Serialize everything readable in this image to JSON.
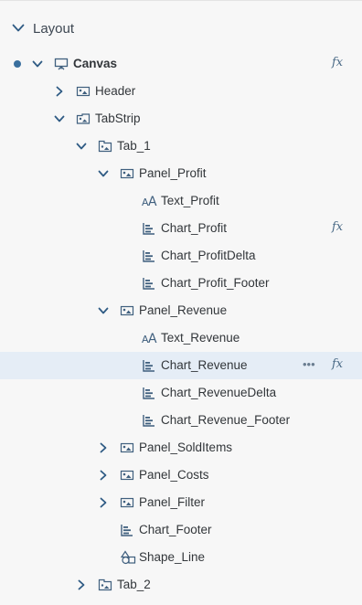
{
  "panel": {
    "title": "Layout"
  },
  "tree": [
    {
      "label": "Canvas",
      "level": 0,
      "expand": "expanded",
      "icon": "canvas-icon",
      "bold": true,
      "dot": true,
      "fx": "fx"
    },
    {
      "label": "Header",
      "level": 1,
      "expand": "collapsed",
      "icon": "panel-icon"
    },
    {
      "label": "TabStrip",
      "level": 1,
      "expand": "expanded",
      "icon": "tabstrip-icon"
    },
    {
      "label": "Tab_1",
      "level": 2,
      "expand": "expanded",
      "icon": "tab-icon"
    },
    {
      "label": "Panel_Profit",
      "level": 3,
      "expand": "expanded",
      "icon": "panel-icon"
    },
    {
      "label": "Text_Profit",
      "level": 4,
      "expand": "none",
      "icon": "text-icon"
    },
    {
      "label": "Chart_Profit",
      "level": 4,
      "expand": "none",
      "icon": "chart-icon",
      "fx": "fx"
    },
    {
      "label": "Chart_ProfitDelta",
      "level": 4,
      "expand": "none",
      "icon": "chart-icon"
    },
    {
      "label": "Chart_Profit_Footer",
      "level": 4,
      "expand": "none",
      "icon": "chart-icon"
    },
    {
      "label": "Panel_Revenue",
      "level": 3,
      "expand": "expanded",
      "icon": "panel-icon"
    },
    {
      "label": "Text_Revenue",
      "level": 4,
      "expand": "none",
      "icon": "text-icon"
    },
    {
      "label": "Chart_Revenue",
      "level": 4,
      "expand": "none",
      "icon": "chart-icon",
      "selected": true,
      "more": "•••",
      "fx": "fx"
    },
    {
      "label": "Chart_RevenueDelta",
      "level": 4,
      "expand": "none",
      "icon": "chart-icon"
    },
    {
      "label": "Chart_Revenue_Footer",
      "level": 4,
      "expand": "none",
      "icon": "chart-icon"
    },
    {
      "label": "Panel_SoldItems",
      "level": 3,
      "expand": "collapsed",
      "icon": "panel-icon"
    },
    {
      "label": "Panel_Costs",
      "level": 3,
      "expand": "collapsed",
      "icon": "panel-icon"
    },
    {
      "label": "Panel_Filter",
      "level": 3,
      "expand": "collapsed",
      "icon": "panel-icon"
    },
    {
      "label": "Chart_Footer",
      "level": 3,
      "expand": "none",
      "icon": "chart-icon"
    },
    {
      "label": "Shape_Line",
      "level": 3,
      "expand": "none",
      "icon": "shape-icon"
    },
    {
      "label": "Tab_2",
      "level": 2,
      "expand": "collapsed",
      "icon": "tab-icon"
    }
  ],
  "colors": {
    "chevron": "#2f5b84",
    "icon": "#3f5f7e",
    "selected_bg": "#e5edf6",
    "dot": "#3a6f9e"
  }
}
